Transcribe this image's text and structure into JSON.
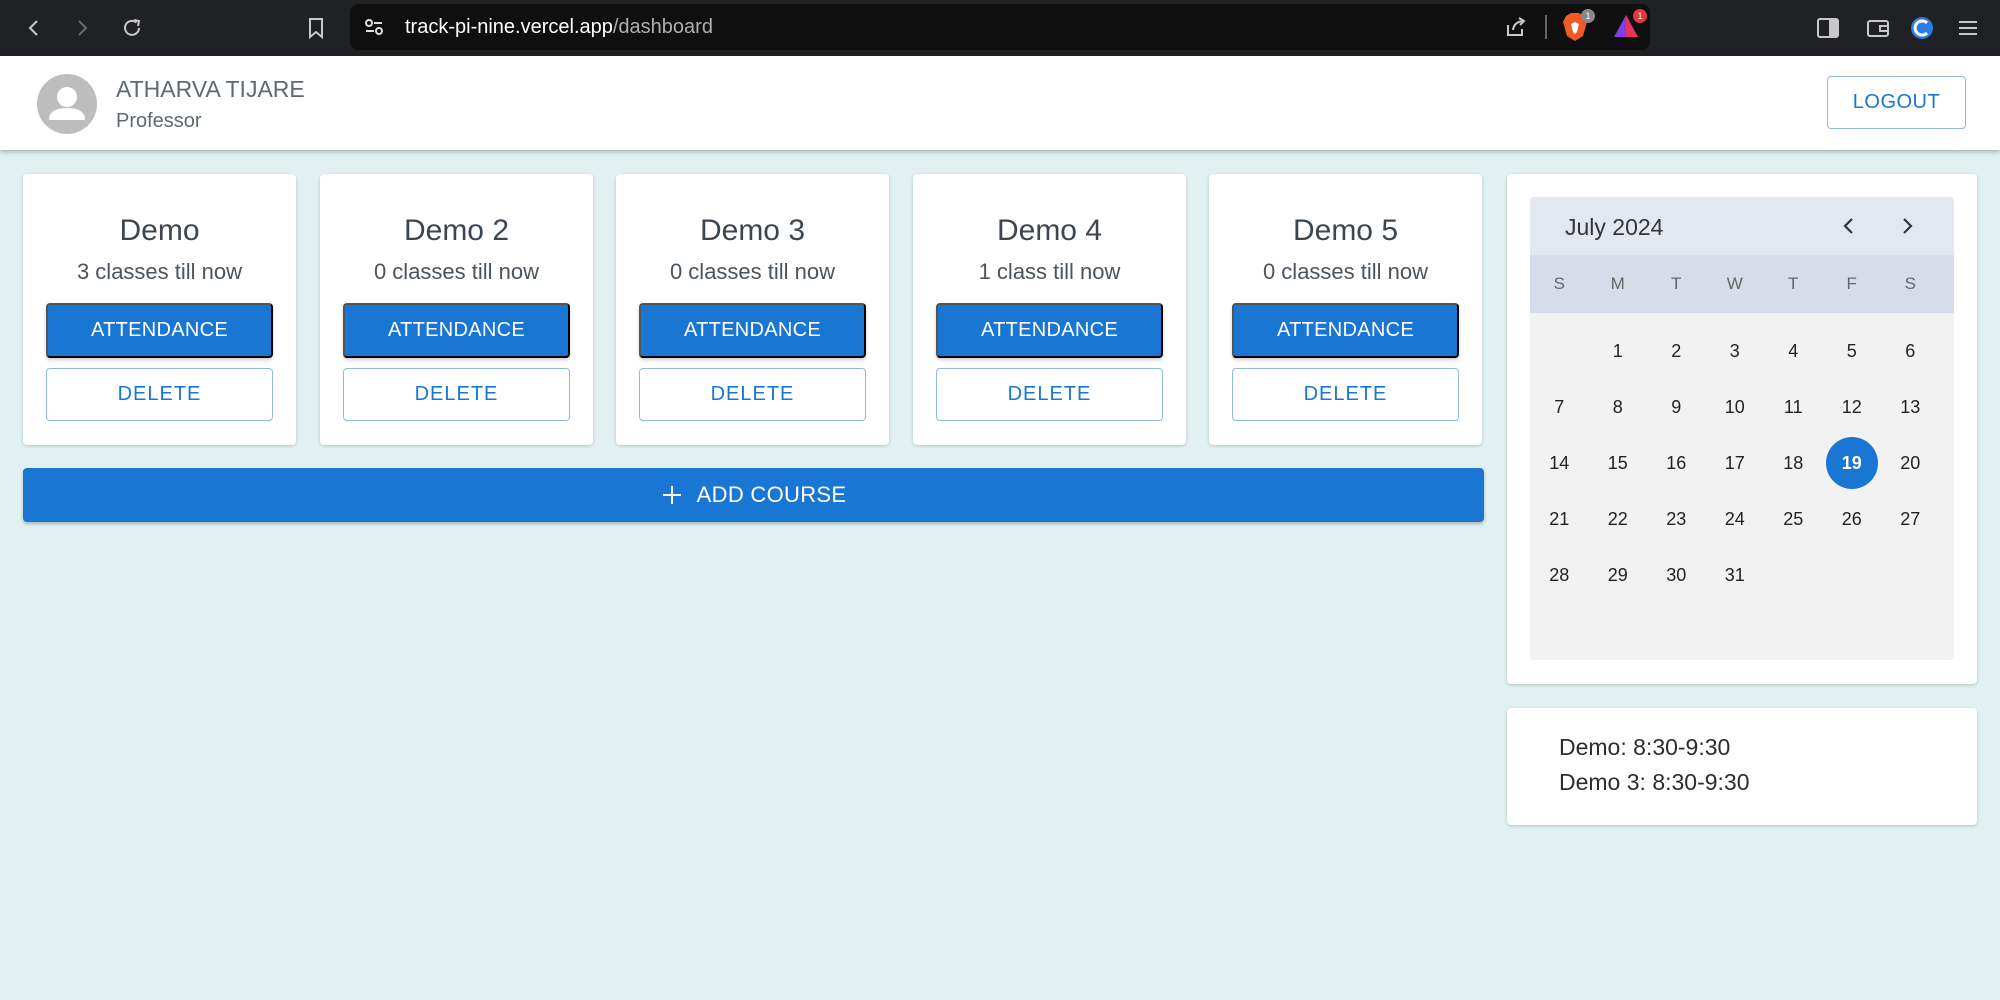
{
  "browser": {
    "url_host": "track-pi-nine.vercel.app",
    "url_path": "/dashboard",
    "brave_badge": "1",
    "rewards_badge": "1"
  },
  "header": {
    "user_name": "ATHARVA TIJARE",
    "user_role": "Professor",
    "logout_label": "LOGOUT"
  },
  "courses": [
    {
      "title": "Demo",
      "classes": "3 classes till now",
      "attendance_label": "ATTENDANCE",
      "delete_label": "DELETE"
    },
    {
      "title": "Demo 2",
      "classes": "0 classes till now",
      "attendance_label": "ATTENDANCE",
      "delete_label": "DELETE"
    },
    {
      "title": "Demo 3",
      "classes": "0 classes till now",
      "attendance_label": "ATTENDANCE",
      "delete_label": "DELETE"
    },
    {
      "title": "Demo 4",
      "classes": "1 class till now",
      "attendance_label": "ATTENDANCE",
      "delete_label": "DELETE"
    },
    {
      "title": "Demo 5",
      "classes": "0 classes till now",
      "attendance_label": "ATTENDANCE",
      "delete_label": "DELETE"
    }
  ],
  "add_course_label": "ADD COURSE",
  "calendar": {
    "month_label": "July 2024",
    "weekdays": [
      "S",
      "M",
      "T",
      "W",
      "T",
      "F",
      "S"
    ],
    "first_weekday_index": 1,
    "days_in_month": 31,
    "selected_day": 19
  },
  "schedule": [
    "Demo: 8:30-9:30",
    "Demo 3: 8:30-9:30"
  ],
  "colors": {
    "primary": "#1976d2",
    "background": "#e1f1f1"
  }
}
